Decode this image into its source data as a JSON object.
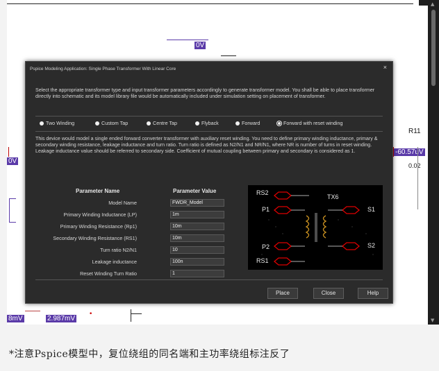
{
  "schematic": {
    "top_voltage": "0V",
    "left_voltage": "0V",
    "resistor_label": "R11",
    "right_voltage": "-60.57uV",
    "resistor_value": "0.02",
    "bottom_voltage_a": "8mV",
    "bottom_voltage_b": "2.987mV"
  },
  "dialog": {
    "title": "Pspice Modeling Application: Single Phase Transformer With Linear Core",
    "close_glyph": "×",
    "intro": "Select the appropriate transformer type and input transformer parameters accordingly to generate transformer model. You shall be able to place transformer directly into schematic and its model library file would be automatically included under simulation setting on placement of transformer.",
    "types": [
      {
        "label": "Two Winding",
        "selected": false
      },
      {
        "label": "Custom Tap",
        "selected": false
      },
      {
        "label": "Centre Tap",
        "selected": false
      },
      {
        "label": "Flyback",
        "selected": false
      },
      {
        "label": "Forward",
        "selected": false
      },
      {
        "label": "Forward with reset winding",
        "selected": true
      }
    ],
    "description": "This device would model a single ended forward converter transformer with auxiliary reset winding. You need to define primary winding inductance, primary & secondary winding resistance, leakage inductance and turn ratio. Turn ratio is defined as N2/N1 and NR/N1, where NR is number of turns in reset winding. Leakage inductance value should be referred to secondary side. Coefficient of mutual coupling between primary and secondary is considered as 1.",
    "param_header_name": "Parameter Name",
    "param_header_value": "Parameter Value",
    "params": [
      {
        "name": "Model Name",
        "value": "FWDR_Model"
      },
      {
        "name": "Primary Winding Inductance (LP)",
        "value": "1m"
      },
      {
        "name": "Primary Winding Resistance (Rp1)",
        "value": "10m"
      },
      {
        "name": "Secondary Winding Resistance (RS1)",
        "value": "10m"
      },
      {
        "name": "Turn ratio N2/N1",
        "value": "10"
      },
      {
        "name": "Leakage inductance",
        "value": "100n"
      },
      {
        "name": "Reset Winding Turn Ratio",
        "value": "1"
      }
    ],
    "preview_labels": {
      "rs2": "RS2",
      "p1": "P1",
      "tx": "TX6",
      "s1": "S1",
      "p2": "P2",
      "s2": "S2",
      "rs1": "RS1"
    },
    "buttons": {
      "place": "Place",
      "close": "Close",
      "help": "Help"
    }
  },
  "note": "*注意Pspice模型中，复位绕组的同名端和主功率绕组标注反了",
  "colors": {
    "dialog_bg": "#2b2b2b",
    "wire": "#5a3aa8",
    "pin": "#cc0000"
  }
}
